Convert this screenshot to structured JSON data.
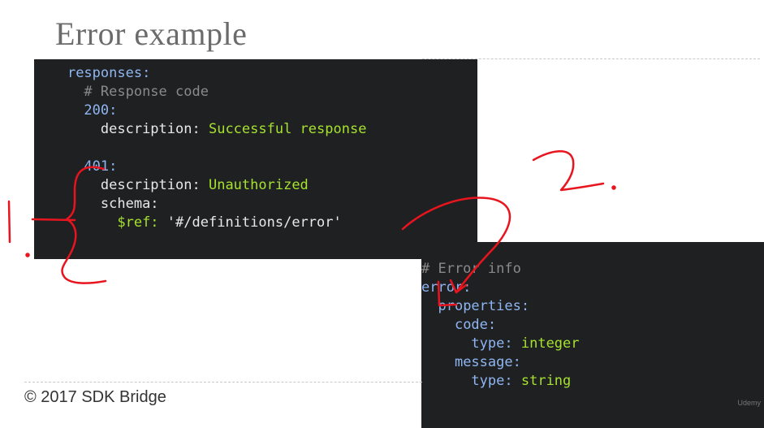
{
  "slide": {
    "title": "Error example",
    "footer": "© 2017 SDK Bridge",
    "watermark": "Udemy"
  },
  "code_responses": {
    "l1_key": "responses:",
    "l2_comment": "# Response code",
    "l3_key": "200:",
    "l4_key": "description:",
    "l4_val": "Successful response",
    "l6_key": "401:",
    "l7_key": "description:",
    "l7_val": "Unauthorized",
    "l8_key": "schema:",
    "l9_key": "$ref:",
    "l9_val": "'#/definitions/error'"
  },
  "code_error": {
    "l1_comment": "# Error info",
    "l2_key": "error:",
    "l3_key": "properties:",
    "l4_key": "code:",
    "l5_key": "type:",
    "l5_val": "integer",
    "l6_key": "message:",
    "l7_key": "type:",
    "l7_val": "string"
  },
  "colors": {
    "code_bg": "#1f2022",
    "key": "#8fb6f2",
    "string": "#a6e22e",
    "comment": "#8a8a8a",
    "ink": "#e8141e"
  },
  "annotations": [
    "brace-annotation",
    "number-1-annotation",
    "number-2-annotation",
    "arrow-annotation",
    "bracket-annotation"
  ]
}
